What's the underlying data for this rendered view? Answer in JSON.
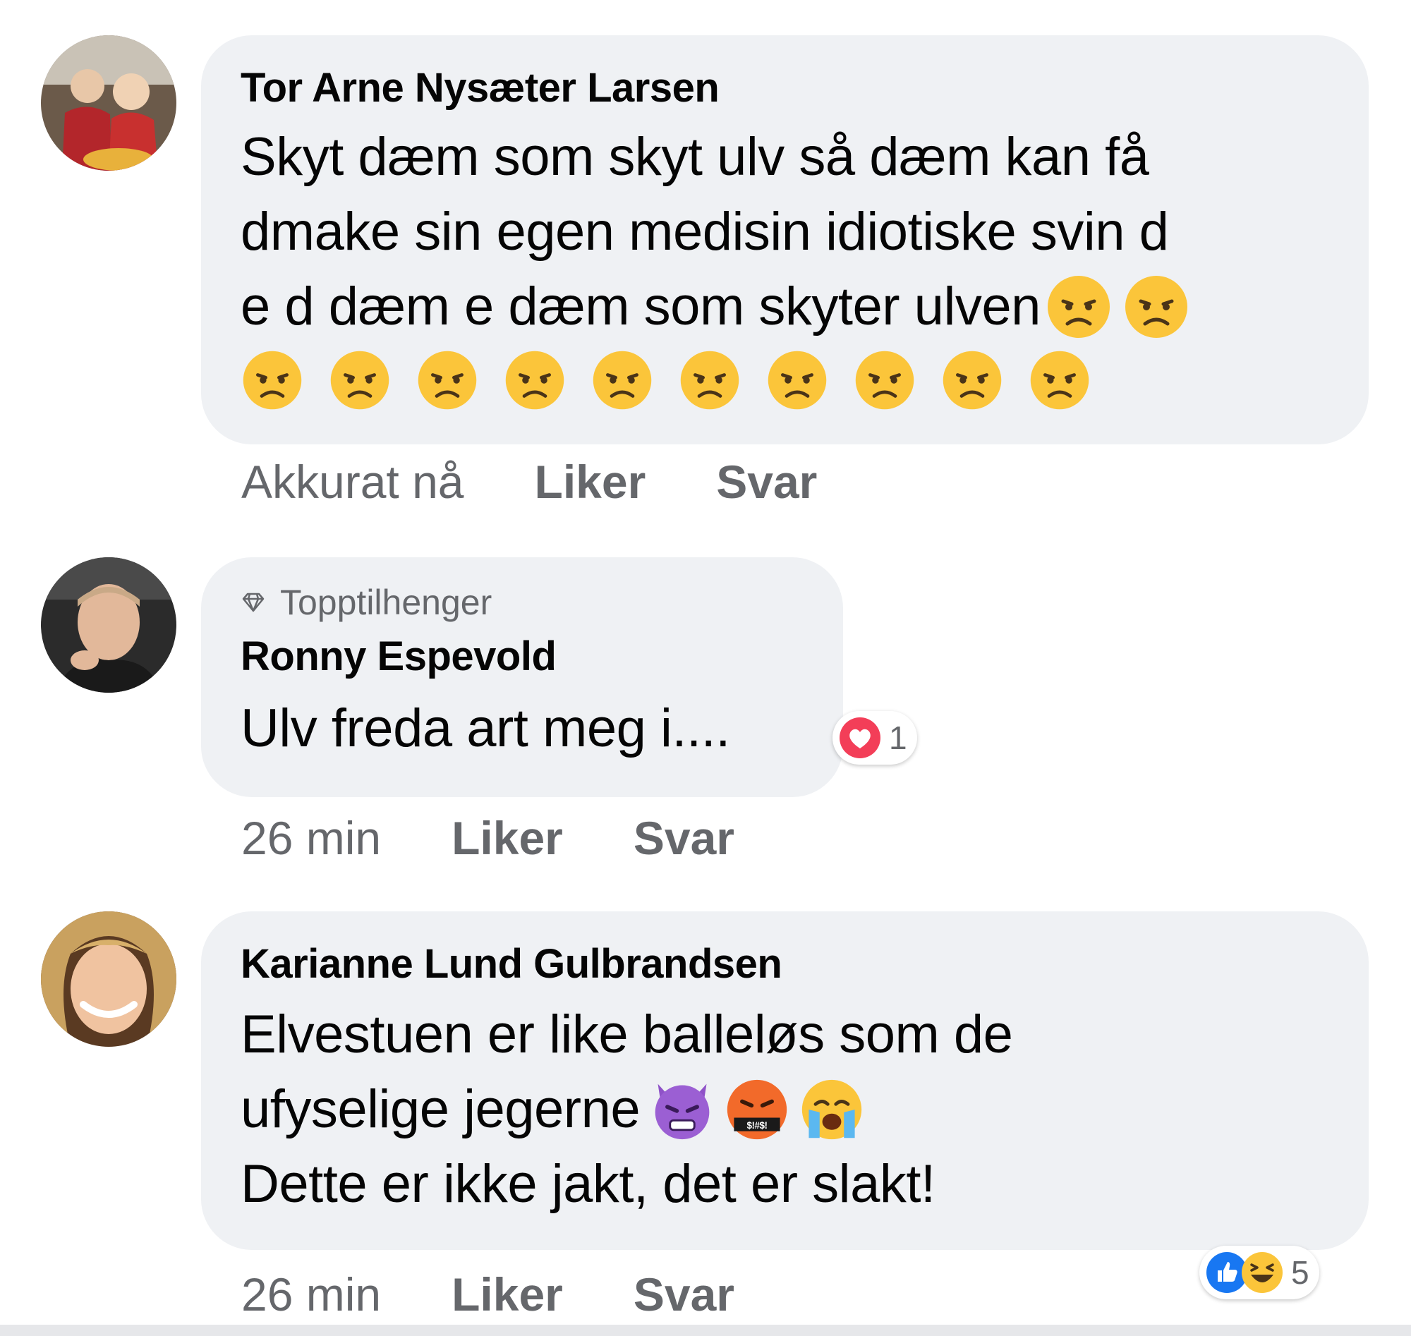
{
  "comments": [
    {
      "author": "Tor Arne Nysæter Larsen",
      "badge": "",
      "lines": [
        "Skyt dæm som skyt ulv så dæm kan få",
        "dmake sin egen medisin idiotiske svin d",
        "e d dæm e dæm som skyter ulven"
      ],
      "emojis_inline": [
        "frowning-face",
        "frowning-face"
      ],
      "emojis_row": [
        "frowning-face",
        "frowning-face",
        "frowning-face",
        "frowning-face",
        "frowning-face",
        "frowning-face",
        "frowning-face",
        "frowning-face",
        "frowning-face",
        "frowning-face"
      ],
      "time": "Akkurat nå",
      "like_label": "Liker",
      "reply_label": "Svar"
    },
    {
      "author": "Ronny Espevold",
      "badge": "Topptilhenger",
      "badge_icon": "diamond-icon",
      "lines": [
        "Ulv freda art meg i...."
      ],
      "reactions": {
        "icons": [
          "heart-reaction-icon"
        ],
        "count": "1"
      },
      "time": "26 min",
      "like_label": "Liker",
      "reply_label": "Svar"
    },
    {
      "author": "Karianne Lund Gulbrandsen",
      "badge": "",
      "lines": [
        "Elvestuen er like balleløs som de",
        "ufyselige jegerne",
        "Dette er ikke jakt, det er slakt!"
      ],
      "emojis_inline": [
        "angry-devil",
        "cursing-face",
        "crying-face"
      ],
      "reactions": {
        "icons": [
          "like-reaction-icon",
          "haha-reaction-icon"
        ],
        "count": "5"
      },
      "time": "26 min",
      "like_label": "Liker",
      "reply_label": "Svar"
    }
  ],
  "colors": {
    "bubble": "#eff1f4",
    "muted": "#65676b",
    "emoji_yellow": "#fbc53a",
    "heart": "#f33e58",
    "like_blue": "#1877f2"
  }
}
